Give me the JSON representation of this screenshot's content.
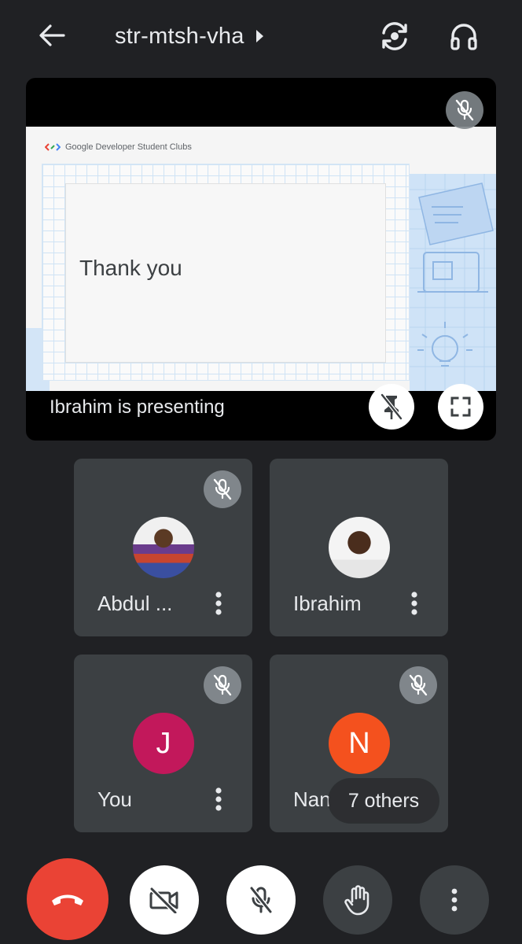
{
  "header": {
    "meeting_code": "str-mtsh-vha",
    "icons": {
      "back": "back-arrow-icon",
      "chevron": "chevron-right-icon",
      "rotate_camera": "switch-camera-icon",
      "audio": "headphones-icon"
    }
  },
  "presentation": {
    "slide_brand": "Google Developer Student Clubs",
    "slide_heading": "Thank you",
    "presenting_label": "Ibrahim is presenting",
    "icons": {
      "mic_muted": "mic-off-icon",
      "unpin": "unpin-icon",
      "fullscreen": "fullscreen-icon"
    }
  },
  "participants": [
    {
      "name": "Abdul ...",
      "avatar_type": "photo",
      "muted": true
    },
    {
      "name": "Ibrahim",
      "avatar_type": "photo",
      "muted": false
    },
    {
      "name": "You",
      "avatar_letter": "J",
      "avatar_color": "#c2185b",
      "muted": true
    },
    {
      "name": "Nana Lawal",
      "avatar_letter": "N",
      "avatar_color": "#f4511e",
      "muted": true
    }
  ],
  "others_pill": "7 others",
  "controls": {
    "end_call": "call-end-icon",
    "camera": "camera-off-icon",
    "microphone": "mic-off-icon",
    "raise_hand": "raise-hand-icon",
    "more": "more-vert-icon"
  },
  "colors": {
    "background": "#202124",
    "tile": "#3c4043",
    "end_call": "#ea4335",
    "badge": "#80868b"
  }
}
